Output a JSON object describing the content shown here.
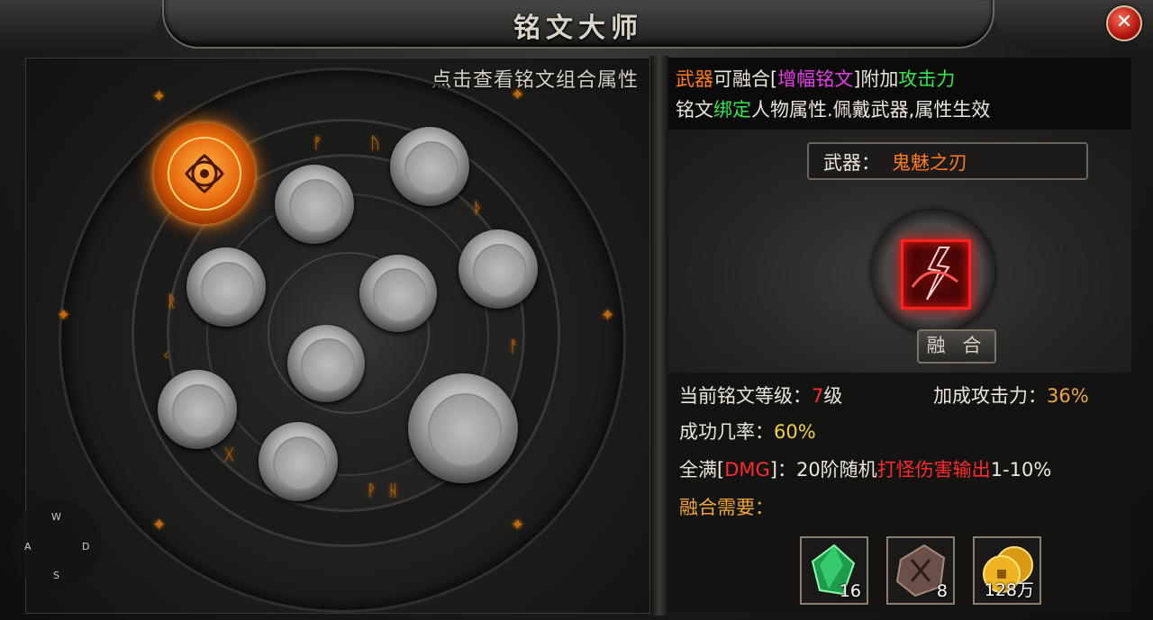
{
  "window": {
    "title": "铭文大师",
    "close_label": "✕"
  },
  "left": {
    "hint": "点击查看铭文组合属性",
    "compass": {
      "up": "W",
      "left": "A",
      "right": "D",
      "down": "S"
    }
  },
  "info": {
    "line1": [
      {
        "text": "武器",
        "color": "orange"
      },
      {
        "text": "可融合[",
        "color": "white"
      },
      {
        "text": "增幅铭文",
        "color": "magenta"
      },
      {
        "text": "]附加",
        "color": "white"
      },
      {
        "text": "攻击力",
        "color": "green"
      }
    ],
    "line2": [
      {
        "text": "铭文",
        "color": "white"
      },
      {
        "text": "绑定",
        "color": "green"
      },
      {
        "text": "人物属性.佩戴武器,属性生效",
        "color": "white"
      }
    ]
  },
  "weapon": {
    "label": "武器：",
    "name": "鬼魅之刃",
    "fuse_button": "融 合"
  },
  "stats": {
    "level_label": "当前铭文等级：",
    "level_value": "7",
    "level_unit": "级",
    "bonus_label": "加成攻击力：",
    "bonus_value": "36%",
    "success_label": "成功几率：",
    "success_value": "60%",
    "full_prefix": "全满[",
    "full_dmg": "DMG",
    "full_mid": "]：20阶随机",
    "full_effect": "打怪伤害输出",
    "full_range": "1-10%",
    "need_label": "融合需要："
  },
  "materials": [
    {
      "icon": "green-gem-icon",
      "count": "16"
    },
    {
      "icon": "stone-ore-icon",
      "count": "8"
    },
    {
      "icon": "gold-coin-icon",
      "count": "128万"
    }
  ],
  "colors": {
    "orange": "#ff7c1a",
    "magenta": "#e93ce9",
    "green": "#33e84a",
    "red": "#ff2a2a",
    "yellow": "#f1d23a",
    "gold": "#f0a636"
  }
}
